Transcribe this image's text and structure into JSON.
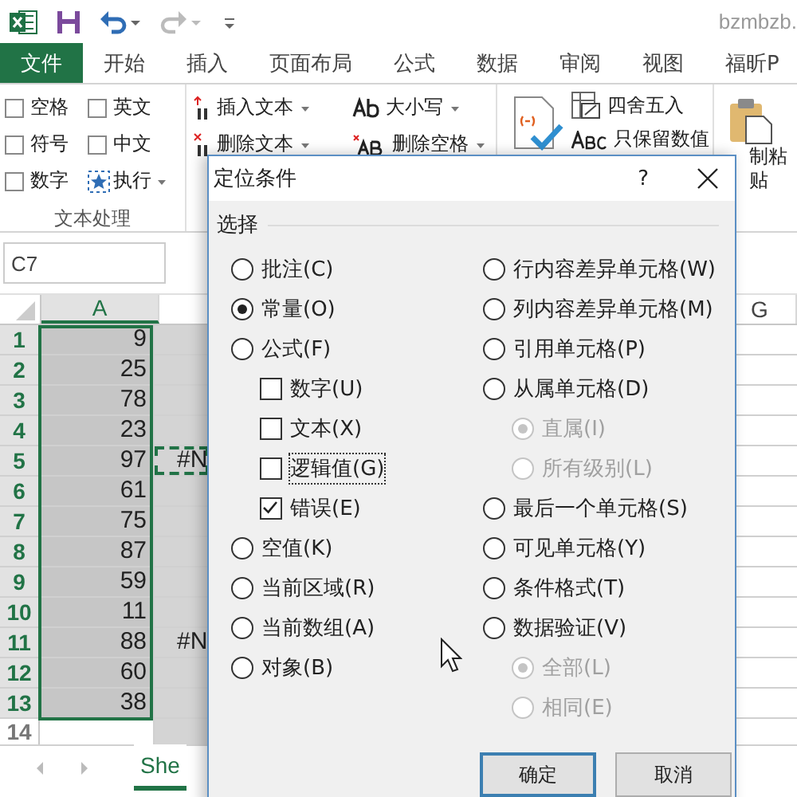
{
  "title_bar": {
    "file_name": "bzmbzb."
  },
  "ribbon_tabs": [
    {
      "label": "文件",
      "kind": "file"
    },
    {
      "label": "开始",
      "kind": "tab"
    },
    {
      "label": "插入",
      "kind": "tab"
    },
    {
      "label": "页面布局",
      "kind": "tab"
    },
    {
      "label": "公式",
      "kind": "tab"
    },
    {
      "label": "数据",
      "kind": "tab"
    },
    {
      "label": "审阅",
      "kind": "tab"
    },
    {
      "label": "视图",
      "kind": "tab"
    },
    {
      "label": "福昕P",
      "kind": "tab"
    }
  ],
  "ribbon": {
    "checkboxes": [
      {
        "label": "空格",
        "checked": false
      },
      {
        "label": "英文",
        "checked": false
      },
      {
        "label": "符号",
        "checked": false
      },
      {
        "label": "中文",
        "checked": false
      },
      {
        "label": "数字",
        "checked": false
      }
    ],
    "run_button": "执行",
    "group_label": "文本处理",
    "text_buttons": [
      {
        "label": "插入文本",
        "kind": "insert"
      },
      {
        "label": "大小写",
        "kind": "case"
      },
      {
        "label": "删除文本",
        "kind": "delete"
      },
      {
        "label": "删除空格",
        "kind": "trim"
      }
    ],
    "number_buttons": [
      {
        "label": "四舍五入",
        "kind": "round"
      },
      {
        "label": "只保留数值",
        "kind": "keep"
      }
    ],
    "paste_button": {
      "lines": [
        "制粘",
        "贴"
      ]
    }
  },
  "name_box": "C7",
  "sheet": {
    "columns": [
      {
        "label": "A",
        "selected": true
      },
      {
        "label": "G",
        "selected": false
      }
    ],
    "rows": [
      {
        "number": "1",
        "column_a": "9",
        "selected": true,
        "copied": false
      },
      {
        "number": "2",
        "column_a": "25",
        "selected": true,
        "copied": false
      },
      {
        "number": "3",
        "column_a": "78",
        "selected": true,
        "copied": false
      },
      {
        "number": "4",
        "column_a": "23",
        "selected": true,
        "copied": false
      },
      {
        "number": "5",
        "column_a": "97",
        "column_b": "#N",
        "selected": true,
        "copied": true
      },
      {
        "number": "6",
        "column_a": "61",
        "selected": true,
        "copied": false
      },
      {
        "number": "7",
        "column_a": "75",
        "selected": true,
        "copied": false
      },
      {
        "number": "8",
        "column_a": "87",
        "selected": true,
        "copied": false
      },
      {
        "number": "9",
        "column_a": "59",
        "selected": true,
        "copied": false
      },
      {
        "number": "10",
        "column_a": "11",
        "selected": true,
        "copied": false
      },
      {
        "number": "11",
        "column_a": "88",
        "column_b": "#N",
        "selected": true,
        "copied": false
      },
      {
        "number": "12",
        "column_a": "60",
        "selected": true,
        "copied": false
      },
      {
        "number": "13",
        "column_a": "38",
        "selected": true,
        "copied": false
      },
      {
        "number": "14",
        "selected": false,
        "copied": false
      }
    ]
  },
  "sheet_tabs": [
    {
      "label": "She",
      "selected": true
    }
  ],
  "dialog": {
    "title": "定位条件",
    "help": "?",
    "group_label": "选择",
    "left_options": [
      {
        "label": "批注(C)",
        "kind": "radio",
        "selected": false,
        "disabled": false
      },
      {
        "label": "常量(O)",
        "kind": "radio",
        "selected": true,
        "disabled": false
      },
      {
        "label": "公式(F)",
        "kind": "radio",
        "selected": false,
        "disabled": false,
        "children": [
          {
            "label": "数字(U)",
            "kind": "checkbox",
            "checked": false,
            "disabled": false,
            "focused": false
          },
          {
            "label": "文本(X)",
            "kind": "checkbox",
            "checked": false,
            "disabled": false,
            "focused": false
          },
          {
            "label": "逻辑值(G)",
            "kind": "checkbox",
            "checked": false,
            "disabled": false,
            "focused": true
          },
          {
            "label": "错误(E)",
            "kind": "checkbox",
            "checked": true,
            "disabled": false,
            "focused": false
          }
        ]
      },
      {
        "label": "空值(K)",
        "kind": "radio",
        "selected": false,
        "disabled": false
      },
      {
        "label": "当前区域(R)",
        "kind": "radio",
        "selected": false,
        "disabled": false
      },
      {
        "label": "当前数组(A)",
        "kind": "radio",
        "selected": false,
        "disabled": false
      },
      {
        "label": "对象(B)",
        "kind": "radio",
        "selected": false,
        "disabled": false
      }
    ],
    "right_options": [
      {
        "label": "行内容差异单元格(W)",
        "kind": "radio",
        "selected": false,
        "disabled": false
      },
      {
        "label": "列内容差异单元格(M)",
        "kind": "radio",
        "selected": false,
        "disabled": false
      },
      {
        "label": "引用单元格(P)",
        "kind": "radio",
        "selected": false,
        "disabled": false
      },
      {
        "label": "从属单元格(D)",
        "kind": "radio",
        "selected": false,
        "disabled": false,
        "children": [
          {
            "label": "直属(I)",
            "kind": "radio",
            "selected": true,
            "disabled": true
          },
          {
            "label": "所有级别(L)",
            "kind": "radio",
            "selected": false,
            "disabled": true
          }
        ]
      },
      {
        "label": "最后一个单元格(S)",
        "kind": "radio",
        "selected": false,
        "disabled": false
      },
      {
        "label": "可见单元格(Y)",
        "kind": "radio",
        "selected": false,
        "disabled": false
      },
      {
        "label": "条件格式(T)",
        "kind": "radio",
        "selected": false,
        "disabled": false
      },
      {
        "label": "数据验证(V)",
        "kind": "radio",
        "selected": false,
        "disabled": false,
        "children": [
          {
            "label": "全部(L)",
            "kind": "radio",
            "selected": true,
            "disabled": true
          },
          {
            "label": "相同(E)",
            "kind": "radio",
            "selected": false,
            "disabled": true
          }
        ]
      }
    ],
    "buttons": [
      {
        "label": "确定",
        "default": true
      },
      {
        "label": "取消",
        "default": false
      }
    ]
  }
}
